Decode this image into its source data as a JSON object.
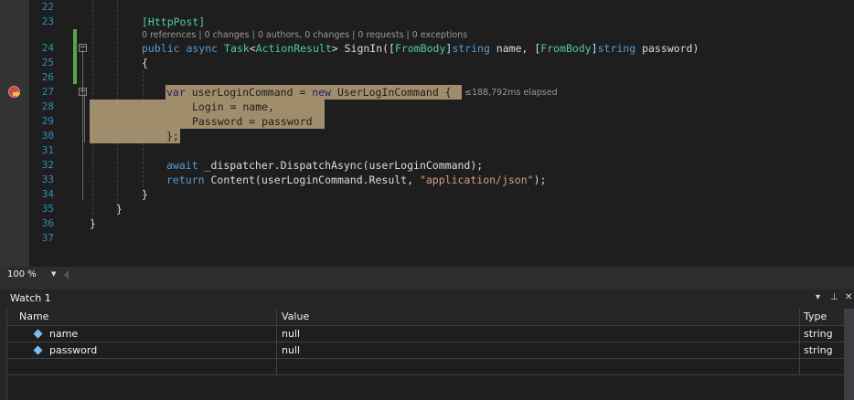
{
  "editor": {
    "line_numbers": [
      "22",
      "23",
      "24",
      "25",
      "26",
      "27",
      "28",
      "29",
      "30",
      "31",
      "32",
      "33",
      "34",
      "35",
      "36",
      "37"
    ],
    "codelens": "0 references | 0 changes | 0 authors, 0 changes | 0 requests | 0 exceptions",
    "elapsed": "≤188,792ms elapsed",
    "lines": {
      "l23": "[HttpPost]",
      "l24a": "public async ",
      "l24b": "Task",
      "l24c": "<",
      "l24d": "ActionResult",
      "l24e": "> SignIn([",
      "l24f": "FromBody",
      "l24g": "]",
      "l24h": "string",
      "l24i": " name, [",
      "l24j": "FromBody",
      "l24k": "]",
      "l24l": "string",
      "l24m": " password)",
      "l25": "{",
      "l27a": "var",
      "l27b": " userLoginCommand = ",
      "l27c": "new",
      "l27d": " UserLogInCommand {",
      "l28": "Login = name,",
      "l29": "Password = password",
      "l30": "};",
      "l32a": "await",
      "l32b": " _dispatcher.DispatchAsync(userLoginCommand);",
      "l33a": "return",
      "l33b": " Content(userLoginCommand.Result, ",
      "l33c": "\"application/json\"",
      "l33d": ");",
      "l34": "}",
      "l35": "}",
      "l36": "}"
    }
  },
  "zoom": {
    "value": "100 %"
  },
  "watch": {
    "title": "Watch 1",
    "columns": {
      "name": "Name",
      "value": "Value",
      "type": "Type"
    },
    "rows": [
      {
        "name": "name",
        "value": "null",
        "type": "string"
      },
      {
        "name": "password",
        "value": "null",
        "type": "string"
      }
    ],
    "buttons": {
      "dropdown": "▾",
      "pin": "⊥",
      "close": "✕"
    }
  }
}
